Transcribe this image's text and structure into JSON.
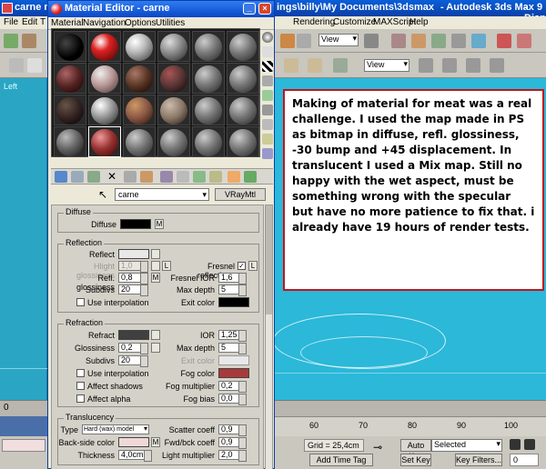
{
  "max_window": {
    "title_left": "carne m",
    "title_path": "ings\\billy\\My Documents\\3dsmax",
    "title_app": "- Autodesk 3ds Max 9",
    "title_right": "- Disp",
    "menu": [
      "File",
      "Edit",
      "T",
      "Rendering",
      "Customize",
      "MAXScript",
      "Help"
    ],
    "view_dropdown": "View",
    "view_dropdown2": "View",
    "viewport_label": "Left"
  },
  "material_editor": {
    "title": "Material Editor - carne",
    "menu": [
      "Material",
      "Navigation",
      "Options",
      "Utilities"
    ],
    "material_name": "carne",
    "material_type": "VRayMtl",
    "diffuse": {
      "group": "Diffuse",
      "label": "Diffuse",
      "map_btn": "M",
      "color": "#000000"
    },
    "reflection": {
      "group": "Reflection",
      "reflect_label": "Reflect",
      "reflect_color": "#e8e8e8",
      "hilight_label": "Hlight glossiness",
      "hilight_value": "1,0",
      "hilight_lock": "L",
      "fresnel_label": "Fresnel reflections",
      "fresnel_checked": "✓",
      "fresnel_lock": "L",
      "refl_gloss_label": "Refl. glossiness",
      "refl_gloss_value": "0,8",
      "fresnel_ior_label": "Fresnel IOR",
      "fresnel_ior_value": "1,6",
      "subdivs_label": "Subdivs",
      "subdivs_value": "20",
      "max_depth_label": "Max depth",
      "max_depth_value": "5",
      "use_interp_label": "Use interpolation",
      "exit_color_label": "Exit color",
      "exit_color": "#000000",
      "map_btn": "M"
    },
    "refraction": {
      "group": "Refraction",
      "refract_label": "Refract",
      "refract_color": "#404040",
      "ior_label": "IOR",
      "ior_value": "1,25",
      "gloss_label": "Glossiness",
      "gloss_value": "0,2",
      "max_depth_label": "Max depth",
      "max_depth_value": "5",
      "subdivs_label": "Subdivs",
      "subdivs_value": "20",
      "exit_color_label": "Exit color",
      "use_interp_label": "Use interpolation",
      "fog_color_label": "Fog color",
      "fog_color": "#a83a3a",
      "affect_shadows_label": "Affect shadows",
      "fog_mult_label": "Fog multiplier",
      "fog_mult_value": "0,2",
      "affect_alpha_label": "Affect alpha",
      "fog_bias_label": "Fog bias",
      "fog_bias_value": "0,0"
    },
    "translucency": {
      "group": "Translucency",
      "type_label": "Type",
      "type_value": "Hard (wax) model",
      "scatter_label": "Scatter coeff",
      "scatter_value": "0,9",
      "back_side_label": "Back-side color",
      "back_side_color": "#f0d8d8",
      "fwd_bck_label": "Fwd/bck coeff",
      "fwd_bck_value": "0,9",
      "thickness_label": "Thickness",
      "thickness_value": "4,0cm",
      "light_mult_label": "Light multiplier",
      "light_mult_value": "2,0",
      "map_btn": "M"
    }
  },
  "note": {
    "text": "Making of material for meat was a real challenge. I used the map made in PS as bitmap in diffuse, refl. glossiness, -30 bump and +45 displacement. In translucent I used a Mix map. Still no happy with the wet aspect, must be something wrong with the specular but have no more patience to fix that.  i already have 19 hours of render tests."
  },
  "bottom": {
    "frame_counter": "0",
    "ruler_ticks": [
      "60",
      "70",
      "80",
      "90",
      "100"
    ],
    "grid_label": "Grid = 25,4cm",
    "auto_key": "Auto Key",
    "set_key": "Set Key",
    "selected": "Selected",
    "key_filters": "Key Filters...",
    "add_time_tag": "Add Time Tag",
    "frame_field": "0"
  },
  "colors": {
    "viewport": "#2bb8d9",
    "note_border": "#c0141c",
    "titlebar": "#0a47c4"
  }
}
